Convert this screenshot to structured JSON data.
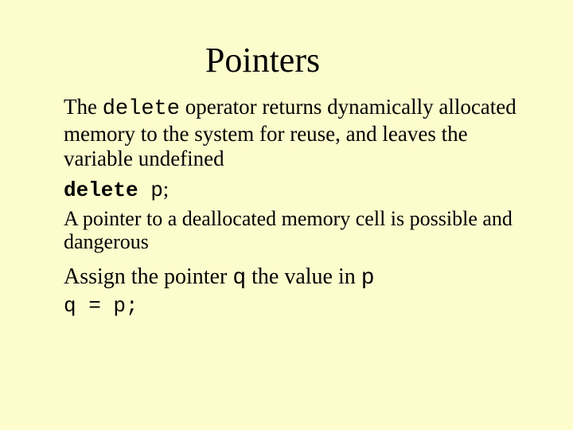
{
  "title": "Pointers",
  "p1": {
    "t1": "The ",
    "code": "delete",
    "t2": " operator returns dynamically allocated memory to the system for reuse, and leaves the variable undefined"
  },
  "codeLine1": {
    "kw": "delete",
    "rest": " p",
    "semi": ";"
  },
  "p2": "A pointer to a deallocated memory cell is possible and dangerous",
  "p3": {
    "t1": "Assign the pointer ",
    "q": "q",
    "t2": " the value in ",
    "p": "p"
  },
  "codeLine2": "q = p;"
}
